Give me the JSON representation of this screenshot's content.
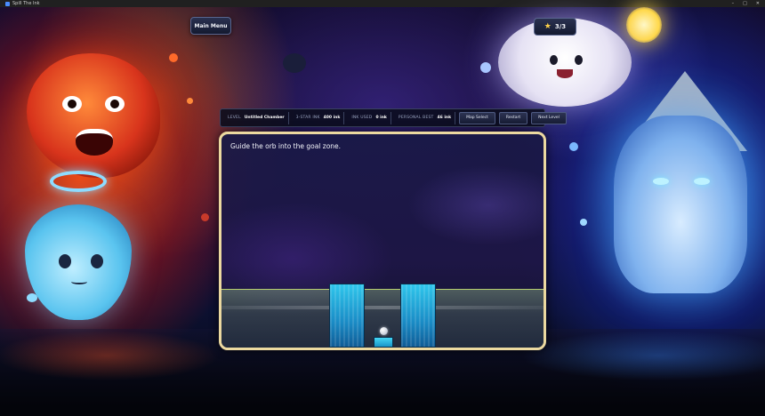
{
  "window": {
    "title": "Spill The Ink",
    "controls": [
      "–",
      "□",
      "✕"
    ]
  },
  "main_menu": {
    "label": "Main Menu"
  },
  "stars": {
    "value": "3/3",
    "icon": "star-icon"
  },
  "hud": {
    "level_key": "LEVEL",
    "level_value": "Untitled Chamber",
    "three_star_key": "3-STAR INK",
    "three_star_value": "400 ink",
    "ink_used_key": "INK USED",
    "ink_used_value": "0 ink",
    "personal_best_key": "PERSONAL BEST",
    "personal_best_value": "46 ink",
    "buttons": {
      "map_select": "Map Select",
      "restart": "Restart",
      "next_level": "Next Level"
    }
  },
  "play_area": {
    "instruction": "Guide the orb into the goal zone."
  },
  "colors": {
    "frame": "#ecd9a0",
    "pillar": "#1a8cc6",
    "goal": "#44d6f4",
    "star": "#ffd24a"
  }
}
